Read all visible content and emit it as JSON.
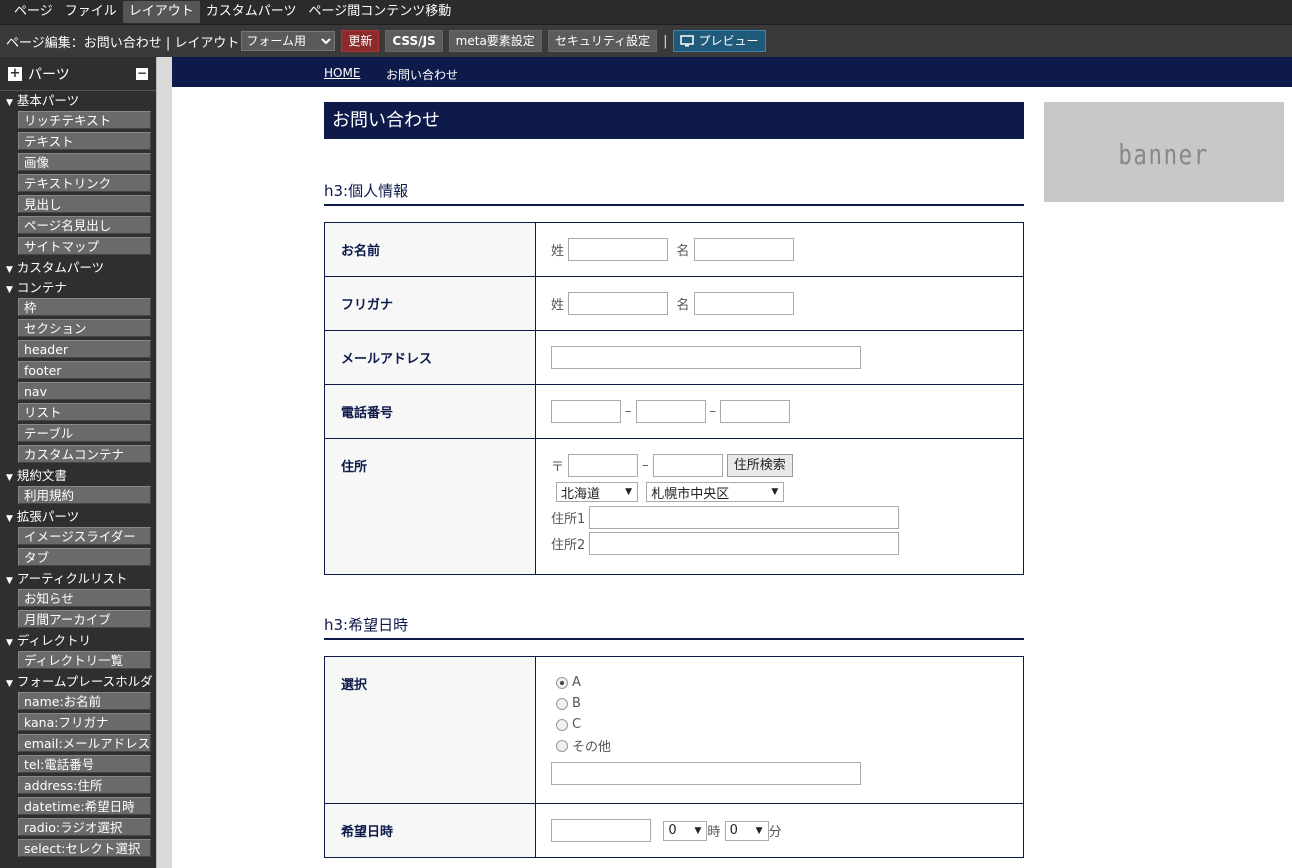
{
  "menu": [
    "ページ",
    "ファイル",
    "レイアウト",
    "カスタムパーツ",
    "ページ間コンテンツ移動"
  ],
  "menu_active_index": 2,
  "toolbar": {
    "breadcrumb": "ページ編集：お問い合わせ | レイアウト",
    "layout_select": "フォーム用",
    "update_label": "更新",
    "cssjs_label": "CSS/JS",
    "meta_label": "meta要素設定",
    "security_label": "セキュリティ設定",
    "separator": "|",
    "preview_label": "プレビュー"
  },
  "sidebar": {
    "title": "パーツ",
    "categories": [
      {
        "name": "基本パーツ",
        "items": [
          "リッチテキスト",
          "テキスト",
          "画像",
          "テキストリンク",
          "見出し",
          "ページ名見出し",
          "サイトマップ"
        ]
      },
      {
        "name": "カスタムパーツ",
        "items": []
      },
      {
        "name": "コンテナ",
        "items": [
          "枠",
          "セクション",
          "header",
          "footer",
          "nav",
          "リスト",
          "テーブル",
          "カスタムコンテナ"
        ]
      },
      {
        "name": "規約文書",
        "items": [
          "利用規約"
        ]
      },
      {
        "name": "拡張パーツ",
        "items": [
          "イメージスライダー",
          "タブ"
        ]
      },
      {
        "name": "アーティクルリスト",
        "items": [
          "お知らせ",
          "月間アーカイブ"
        ]
      },
      {
        "name": "ディレクトリ",
        "items": [
          "ディレクトリ一覧"
        ]
      },
      {
        "name": "フォームプレースホルダ",
        "items": [
          "name:お名前",
          "kana:フリガナ",
          "email:メールアドレス",
          "tel:電話番号",
          "address:住所",
          "datetime:希望日時",
          "radio:ラジオ選択",
          "select:セレクト選択"
        ]
      }
    ]
  },
  "breadcrumb": {
    "home": "HOME",
    "current": "お問い合わせ"
  },
  "page_title": "お問い合わせ",
  "banner_text": "banner",
  "section1": {
    "heading": "h3:個人情報",
    "name_label": "お名前",
    "kana_label": "フリガナ",
    "email_label": "メールアドレス",
    "tel_label": "電話番号",
    "address_label": "住所",
    "sei": "姓",
    "mei": "名",
    "dash": "–",
    "postal_mark": "〒",
    "address_search": "住所検索",
    "prefecture": "北海道",
    "city": "札幌市中央区",
    "address1": "住所1",
    "address2": "住所2"
  },
  "section2": {
    "heading": "h3:希望日時",
    "select_label": "選択",
    "options": [
      "A",
      "B",
      "C",
      "その他"
    ],
    "selected_index": 0,
    "datetime_label": "希望日時",
    "hour_value": "0",
    "hour_unit": "時",
    "minute_value": "0",
    "minute_unit": "分"
  }
}
